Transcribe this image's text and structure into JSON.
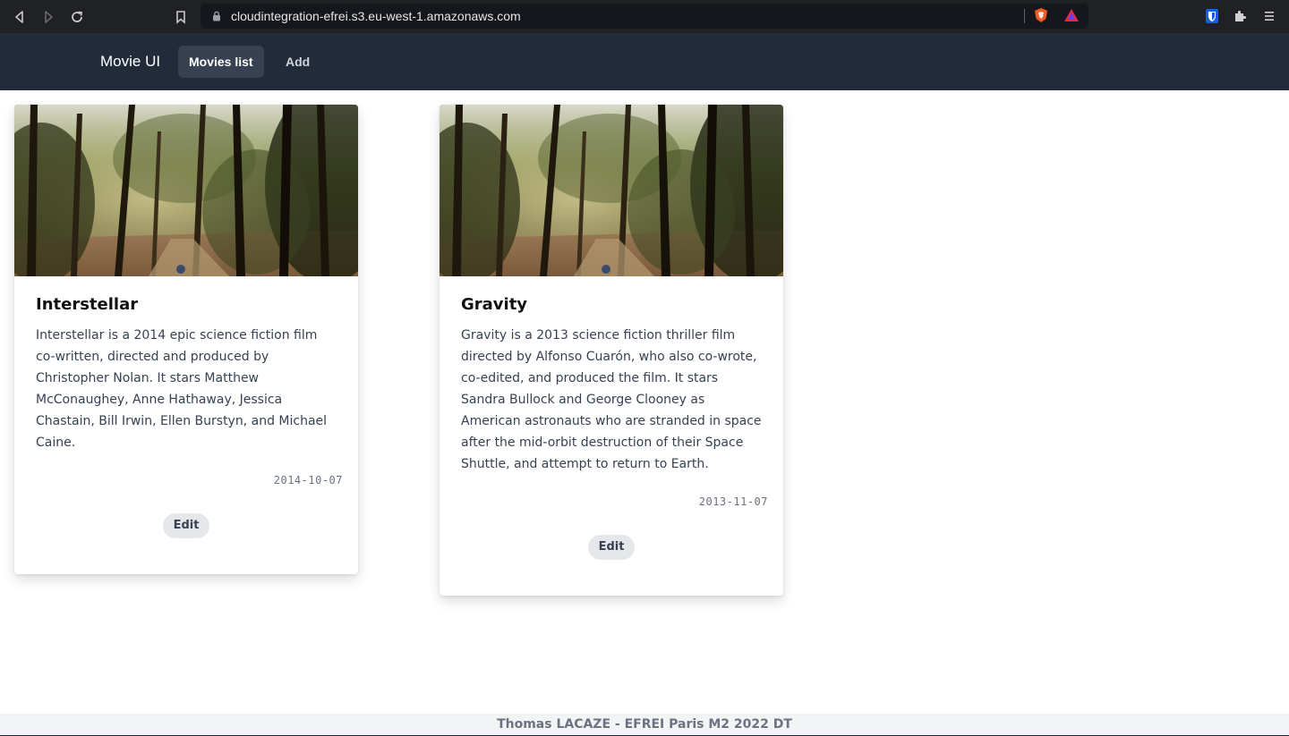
{
  "browser": {
    "url": "cloudintegration-efrei.s3.eu-west-1.amazonaws.com",
    "icons": [
      "back-icon",
      "forward-icon",
      "reload-icon",
      "bookmark-icon",
      "lock-icon",
      "brave-shield-icon",
      "brave-rewards-icon",
      "bitwarden-icon",
      "extensions-icon",
      "menu-icon"
    ]
  },
  "navbar": {
    "brand": "Movie UI",
    "links": [
      {
        "label": "Movies list",
        "active": true
      },
      {
        "label": "Add",
        "active": false
      }
    ]
  },
  "movies": [
    {
      "title": "Interstellar",
      "description": "Interstellar is a 2014 epic science fiction film co-written, directed and produced by Christopher Nolan. It stars Matthew McConaughey, Anne Hathaway, Jessica Chastain, Bill Irwin, Ellen Burstyn, and Michael Caine.",
      "date": "2014-10-07",
      "edit_label": "Edit"
    },
    {
      "title": "Gravity",
      "description": "Gravity is a 2013 science fiction thriller film directed by Alfonso Cuarón, who also co-wrote, co-edited, and produced the film. It stars Sandra Bullock and George Clooney as American astronauts who are stranded in space after the mid-orbit destruction of their Space Shuttle, and attempt to return to Earth.",
      "date": "2013-11-07",
      "edit_label": "Edit"
    }
  ],
  "footer": {
    "text": "Thomas LACAZE - EFREI Paris M2 2022 DT"
  },
  "colors": {
    "navbar_bg": "#222b3a",
    "browser_bg": "#202124",
    "active_link_bg": "#374151",
    "footer_bg": "#f3f4f6"
  }
}
